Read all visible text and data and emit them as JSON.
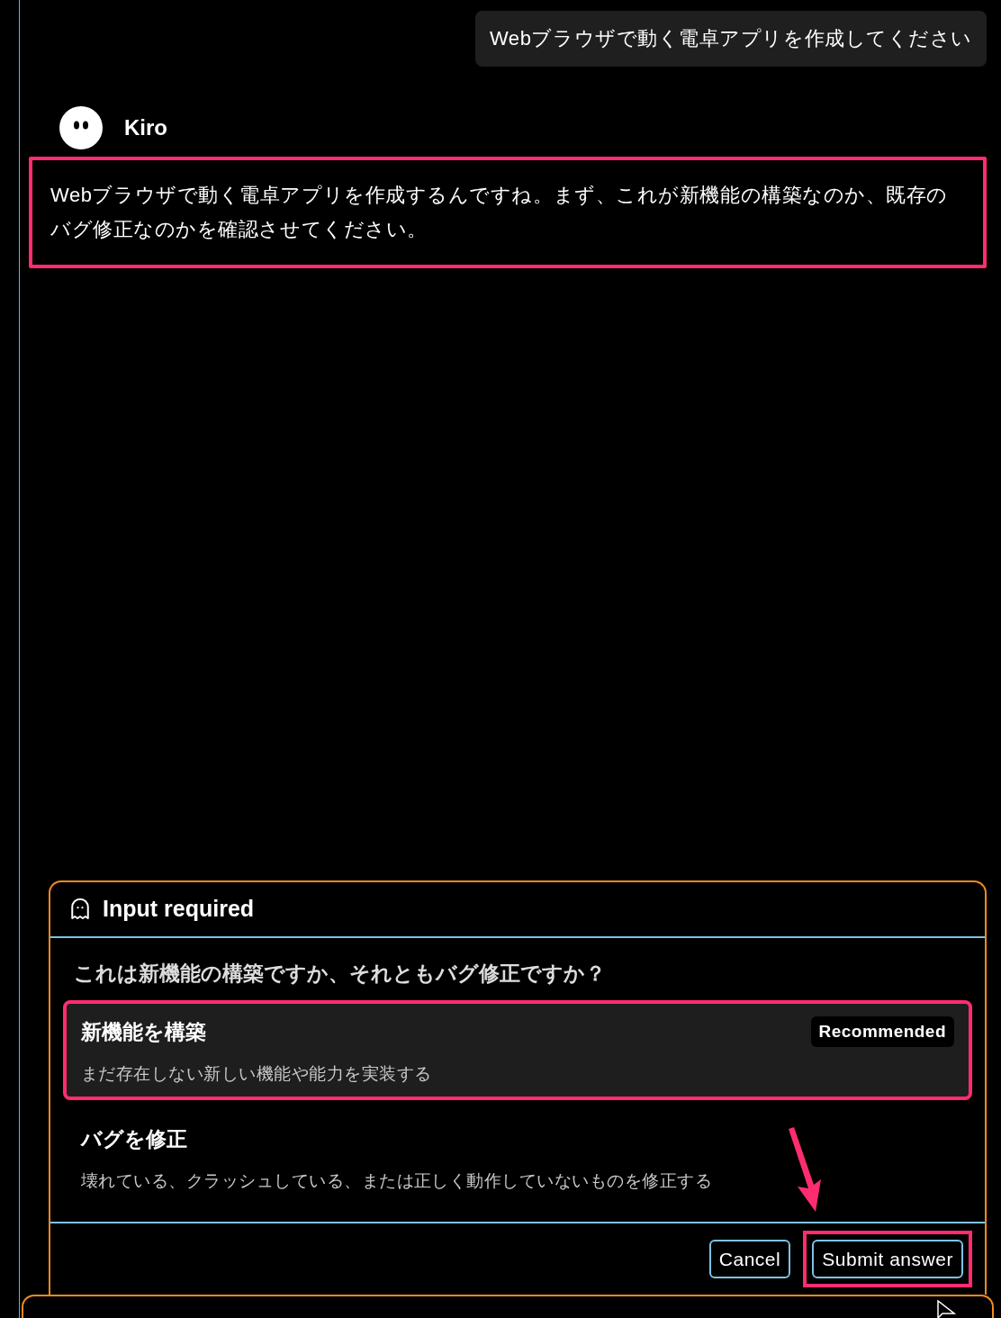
{
  "user_message": {
    "text": "Webブラウザで動く電卓アプリを作成してください"
  },
  "agent": {
    "name": "Kiro",
    "message": "Webブラウザで動く電卓アプリを作成するんですね。まず、これが新機能の構築なのか、既存のバグ修正なのかを確認させてください。",
    "highlighted": true
  },
  "input_panel": {
    "title": "Input required",
    "question": "これは新機能の構築ですか、それともバグ修正ですか？",
    "options": [
      {
        "label": "新機能を構築",
        "description": "まだ存在しない新しい機能や能力を実装する",
        "badge": "Recommended",
        "selected": true,
        "highlighted": true
      },
      {
        "label": "バグを修正",
        "description": "壊れている、クラッシュしている、または正しく動作していないものを修正する",
        "selected": false,
        "highlighted": false
      }
    ],
    "buttons": [
      {
        "label": "Cancel",
        "highlighted": false
      },
      {
        "label": "Submit answer",
        "highlighted": true
      }
    ]
  }
}
